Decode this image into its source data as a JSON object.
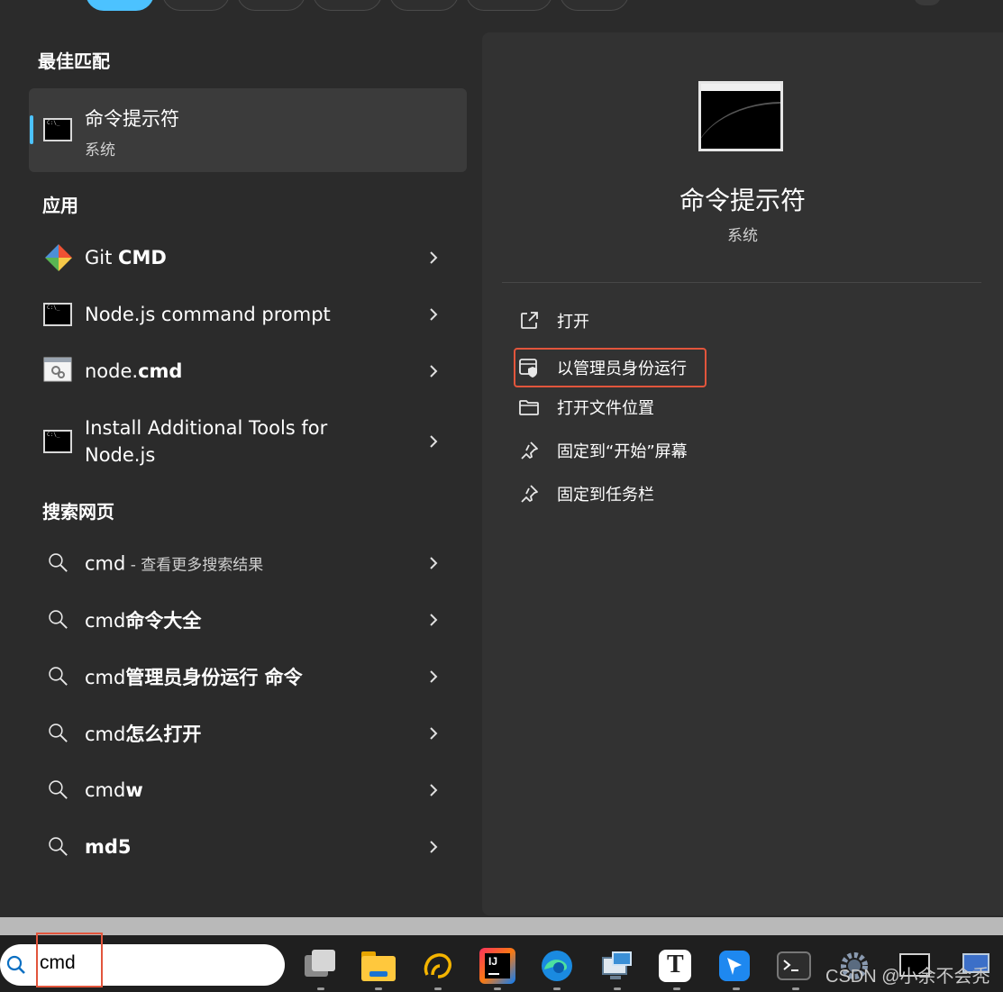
{
  "sections": {
    "best_match": "最佳匹配",
    "apps": "应用",
    "web": "搜索网页"
  },
  "best_match_item": {
    "title": "命令提示符",
    "subtitle": "系统"
  },
  "apps": [
    {
      "name_plain": "Git ",
      "name_bold": "CMD",
      "icon": "git-icon"
    },
    {
      "name_plain": "Node.js command prompt",
      "name_bold": "",
      "icon": "cmd-icon"
    },
    {
      "name_plain": "node.",
      "name_bold": "cmd",
      "icon": "batch-file-icon"
    },
    {
      "line1": "Install Additional Tools for",
      "line2": "Node.js",
      "icon": "cmd-icon"
    }
  ],
  "web_results": [
    {
      "query_plain": "cmd",
      "query_bold": "",
      "suffix": " - 查看更多搜索结果"
    },
    {
      "query_plain": "cmd",
      "query_bold": "命令大全",
      "suffix": ""
    },
    {
      "query_plain": "cmd",
      "query_bold": "管理员身份运行 命令",
      "suffix": ""
    },
    {
      "query_plain": "cmd",
      "query_bold": "怎么打开",
      "suffix": ""
    },
    {
      "query_plain": "cmd",
      "query_bold": "w",
      "suffix": ""
    },
    {
      "query_plain": "",
      "query_bold": "md5",
      "suffix": ""
    }
  ],
  "preview": {
    "title": "命令提示符",
    "subtitle": "系统"
  },
  "actions": [
    {
      "label": "打开",
      "icon": "open-external-icon"
    },
    {
      "label": "以管理员身份运行",
      "icon": "shield-admin-icon"
    },
    {
      "label": "打开文件位置",
      "icon": "folder-icon"
    },
    {
      "label": "固定到“开始”屏幕",
      "icon": "pin-icon"
    },
    {
      "label": "固定到任务栏",
      "icon": "pin-icon"
    }
  ],
  "taskbar": {
    "search_value": "cmd",
    "apps": [
      "file-explorer-icon",
      "folder-icon",
      "navicat-icon",
      "intellij-idea-icon",
      "edge-icon",
      "remote-desktop-icon",
      "typora-icon",
      "feishu-icon",
      "terminal-icon",
      "settings-icon",
      "cmd-icon",
      "network-icon"
    ]
  },
  "watermark": "CSDN @小余不会秃",
  "colors": {
    "accent": "#4cc2ff",
    "highlight_border": "#e2553c",
    "panel_bg": "#2b2b2b",
    "preview_bg": "#323232"
  }
}
